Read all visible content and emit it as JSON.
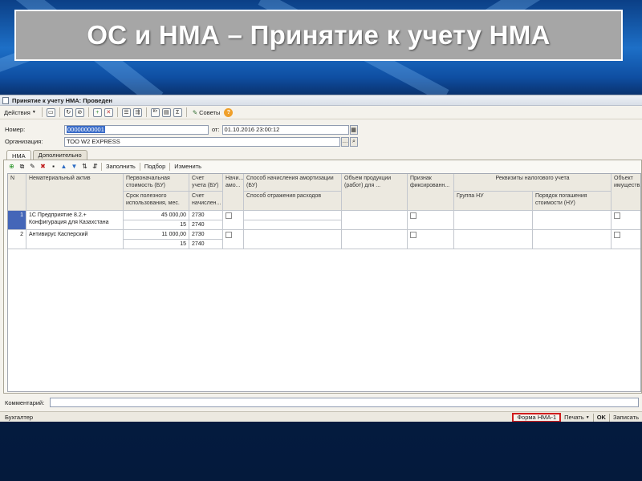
{
  "slide": {
    "title": "ОС и НМА – Принятие к учету НМА"
  },
  "window": {
    "title": "Принятие к учету НМА: Проведен",
    "toolbar": {
      "actions_label": "Действия",
      "tips_label": "Советы"
    }
  },
  "form": {
    "number_label": "Номер:",
    "number_value": "00000000001",
    "date_label": "от:",
    "date_value": "01.10.2016 23:00:12",
    "org_label": "Организация:",
    "org_value": "ТОО W2 EXPRESS"
  },
  "tabs": [
    {
      "label": "НМА"
    },
    {
      "label": "Дополнительно"
    }
  ],
  "grid_toolbar": {
    "fill_label": "Заполнить",
    "select_label": "Подбор",
    "change_label": "Изменить"
  },
  "table": {
    "headers": {
      "n": "N",
      "asset": "Нематериальный актив",
      "initial_cost": "Первоначальная стоимость (БУ)",
      "useful_life": "Срок полезного использования, мес.",
      "account": "Счет учета (БУ)",
      "amort_account": "Счет начислен...",
      "accrue_amort": "Начи... амо...",
      "amort_method": "Способ начисления амортизации (БУ)",
      "expense_method": "Способ отражения расходов",
      "production_volume": "Объем продукции (работ) для ...",
      "fixed_flag": "Признак фиксированн...",
      "tax_group_header": "Реквизиты налогового учета",
      "tax_group": "Группа НУ",
      "repayment_order": "Порядок погашения стоимости (НУ)",
      "property_object": "Объект имуществ..."
    },
    "rows": [
      {
        "n": "1",
        "asset": "1С Предприятие 8.2.+ Конфигурация для Казахстана",
        "initial_cost": "45 000,00",
        "useful_life": "15",
        "account": "2730",
        "amort_account": "2740"
      },
      {
        "n": "2",
        "asset": "Антивирус Касперский",
        "initial_cost": "11 000,00",
        "useful_life": "15",
        "account": "2730",
        "amort_account": "2740"
      }
    ]
  },
  "comment": {
    "label": "Комментарий:",
    "value": ""
  },
  "status_bar": {
    "user": "Бухгалтер",
    "form_button": "Форма НМА-1",
    "print_button": "Печать",
    "ok_button": "OK",
    "save_button": "Записать"
  },
  "colors": {
    "title_box": "#a6a6a6",
    "slide_bg": "#041a3c",
    "selected_row": "#4466b8",
    "highlight_border": "#d01c1c"
  }
}
